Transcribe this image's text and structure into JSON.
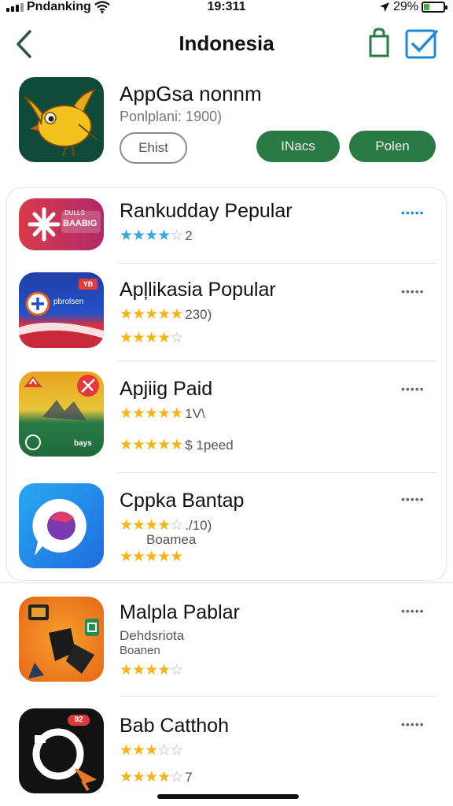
{
  "status_bar": {
    "carrier": "Pndanking",
    "time": "19:311",
    "battery": "29%",
    "battery_level": 0.29
  },
  "nav": {
    "title": "Indonesia"
  },
  "header_app": {
    "name": "AppGsa nonnm",
    "subtitle": "Ponlplani:  1900)",
    "buttons": {
      "outline": "Ehist",
      "green_1": "INacs",
      "green_2": "Polen"
    }
  },
  "apps": [
    {
      "title": "Rankudday Pepular",
      "more": "•••••",
      "rating_1": {
        "stars": 4,
        "max": 5,
        "text": "2"
      },
      "icon_text": {
        "line1": "DULLS",
        "line2": "BAABIG"
      }
    },
    {
      "title": "Apļlikasia Popular",
      "more": "•••••",
      "rating_1": {
        "stars": 5,
        "max": 5,
        "text": "230)"
      },
      "rating_2": {
        "stars": 4,
        "max": 5,
        "text": ""
      },
      "icon_text": {
        "badge": "YB",
        "line1": "pbrolsen"
      }
    },
    {
      "title": "Apjiig Paid",
      "more": "•••••",
      "rating_1": {
        "stars": 5,
        "max": 5,
        "text": "1V\\"
      },
      "rating_2": {
        "stars": 5,
        "max": 5,
        "text": "$ 1peed"
      },
      "icon_text": {
        "badge": "bays"
      }
    },
    {
      "title": "Cppka Bantap",
      "more": "•••••",
      "rating_1": {
        "stars": 4,
        "max": 5,
        "text": "./10)"
      },
      "caption": "Boamea",
      "rating_2": {
        "stars": 5,
        "max": 5,
        "text": ""
      }
    },
    {
      "title": "Malpla Pablar",
      "more": "•••••",
      "text_1": "Dehdsriota",
      "text_2": "Boanen",
      "rating_1": {
        "stars": 4,
        "max": 5,
        "text": ""
      }
    },
    {
      "title": "Bab Catthoh",
      "more": "•••••",
      "rating_1": {
        "stars": 3,
        "max": 5,
        "text": ""
      },
      "rating_2": {
        "stars": 4,
        "max": 5,
        "text": "7"
      },
      "icon_text": {
        "badge": "92"
      }
    }
  ],
  "colors": {
    "accent_green": "#2a7a45",
    "accent_blue": "#1e88d6",
    "star_gold": "#f0b41c",
    "star_blue": "#38a7e0"
  },
  "icons": [
    "back-chevron-icon",
    "shopping-bag-icon",
    "checkbox-icon",
    "wifi-icon",
    "location-arrow-icon",
    "battery-icon"
  ]
}
